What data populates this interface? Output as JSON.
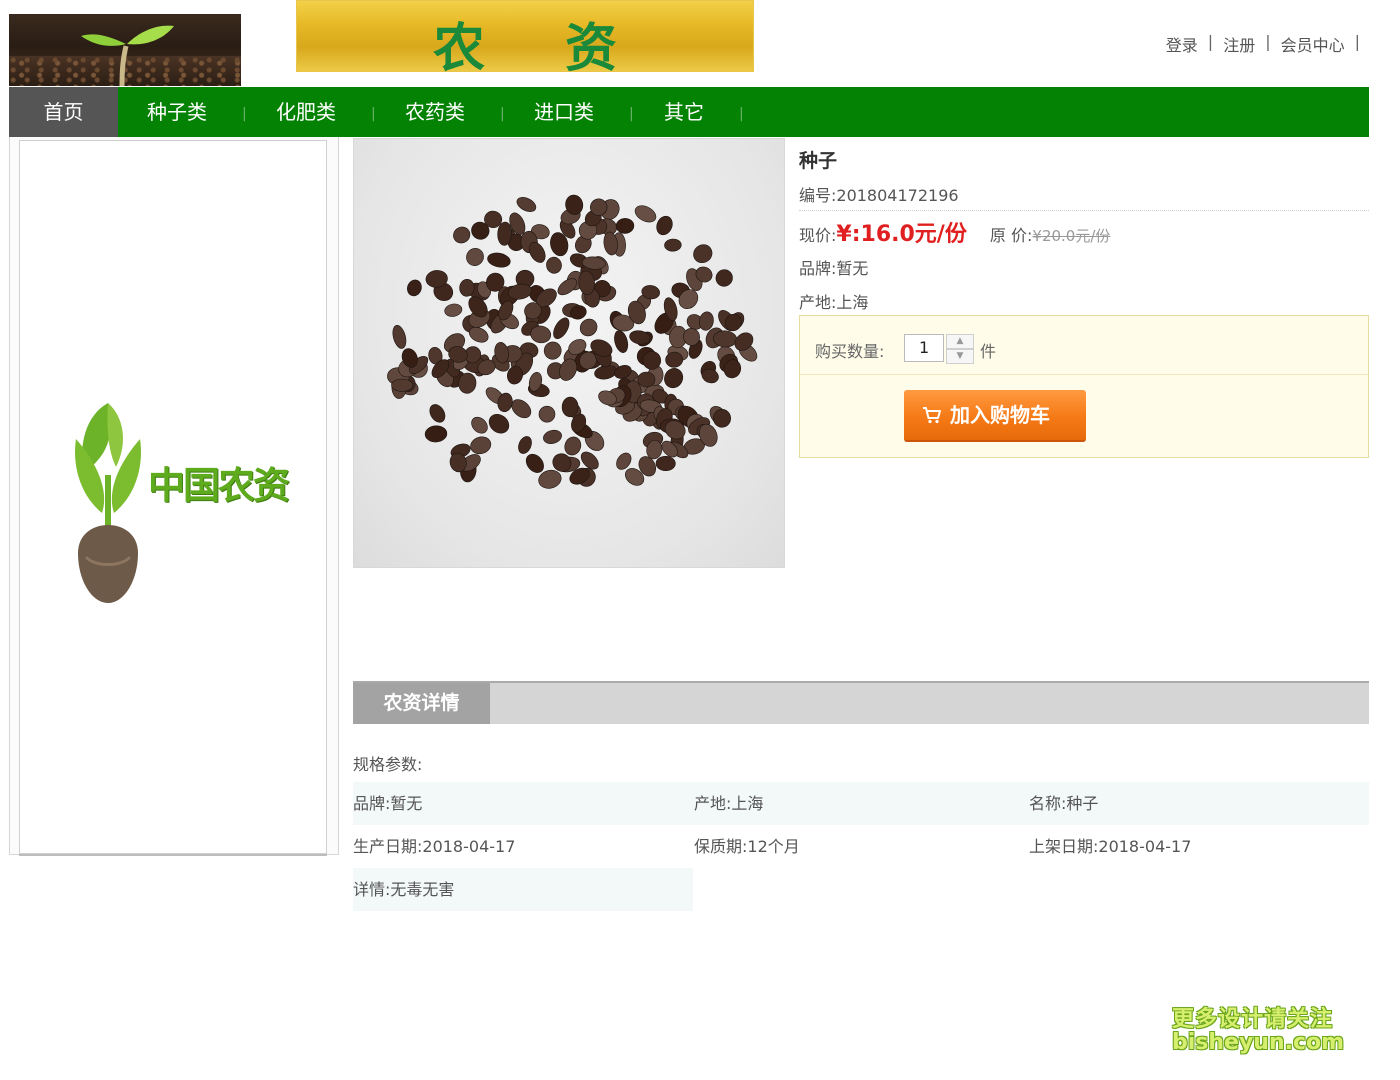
{
  "header": {
    "banner_text": "农资",
    "links": [
      "登录",
      "注册",
      "会员中心"
    ]
  },
  "nav": {
    "items": [
      "首页",
      "种子类",
      "化肥类",
      "农药类",
      "进口类",
      "其它"
    ],
    "active": "首页"
  },
  "aside": {
    "logo_text": "中国农资"
  },
  "product": {
    "name": "种子",
    "code": "编号:201804172196",
    "price_label": "现价:",
    "price": "¥:16.0元/份",
    "orig_label": "原 价:",
    "orig_price": "¥20.0元/份",
    "brand": "品牌:暂无",
    "origin": "产地:上海"
  },
  "buy": {
    "qty_label": "购买数量:",
    "qty_value": "1",
    "unit": "件",
    "cart_button": "加入购物车"
  },
  "details": {
    "tab": "农资详情",
    "spec_heading": "规格参数:",
    "rows": [
      [
        "品牌:暂无",
        "产地:上海",
        "名称:种子"
      ],
      [
        "生产日期:2018-04-17",
        "保质期:12个月",
        "上架日期:2018-04-17"
      ]
    ],
    "last": "详情:无毒无害"
  },
  "watermark": {
    "line1": "更多设计请关注",
    "line2": "bisheyun.com"
  },
  "colors": {
    "nav_green": "#038203",
    "nav_active": "#555555",
    "price_red": "#e02020",
    "cart_orange": "#f57a16"
  }
}
